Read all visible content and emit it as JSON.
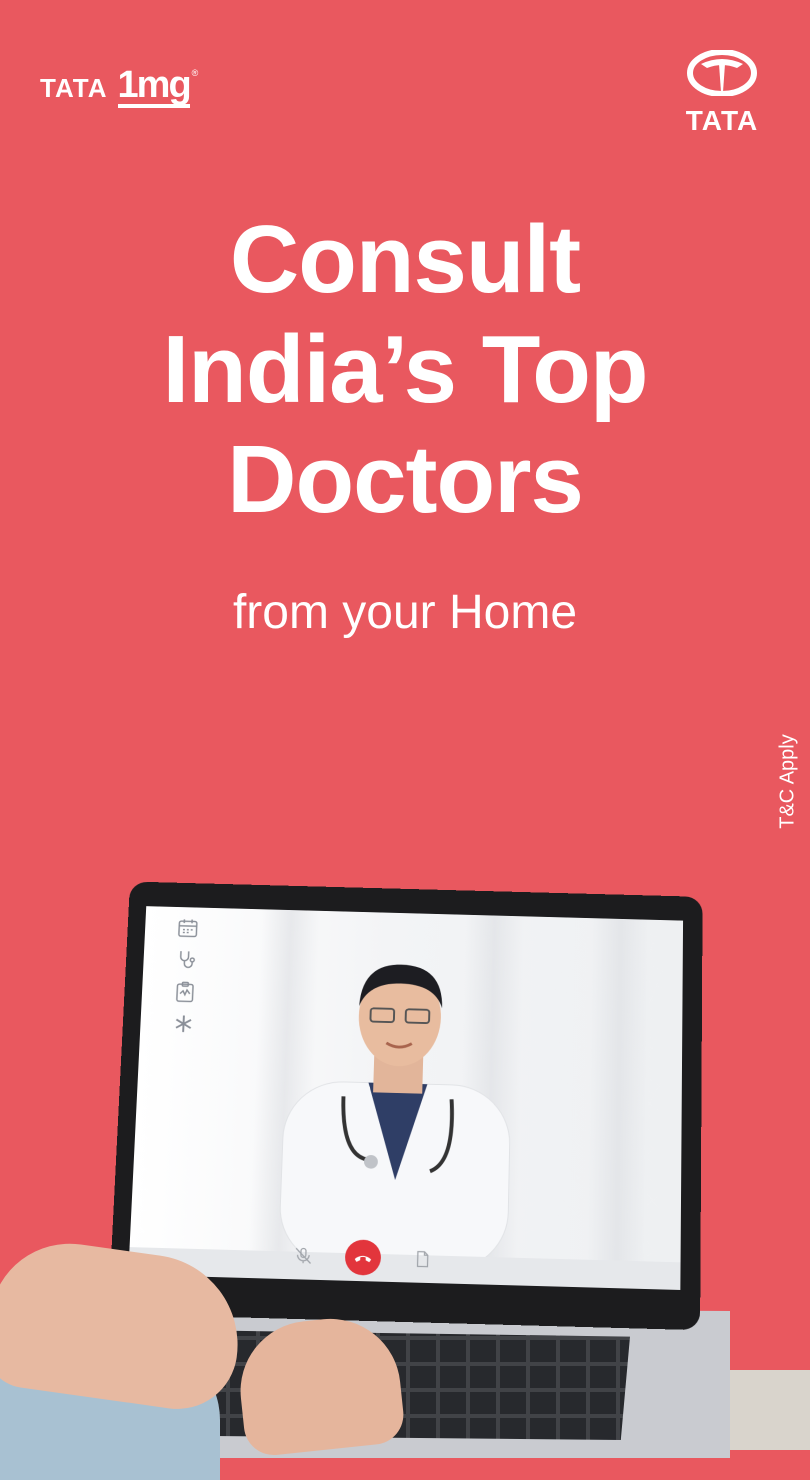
{
  "brand_left": {
    "tata_text": "TATA",
    "mg_text": "1mg",
    "reg_mark": "®"
  },
  "brand_right": {
    "tata_text": "TATA"
  },
  "headline": {
    "line1": "Consult",
    "line2": "India’s Top",
    "line3": "Doctors"
  },
  "subhead": "from your Home",
  "tnc": "T&C Apply",
  "colors": {
    "background": "#E9585F",
    "end_call": "#E2353C",
    "text": "#FFFFFF"
  },
  "laptop_screen": {
    "side_icons": [
      "calendar-icon",
      "stethoscope-icon",
      "clipboard-icon",
      "asterisk-icon"
    ],
    "call_controls": [
      "mic-off-icon",
      "end-call-icon",
      "document-icon"
    ]
  }
}
